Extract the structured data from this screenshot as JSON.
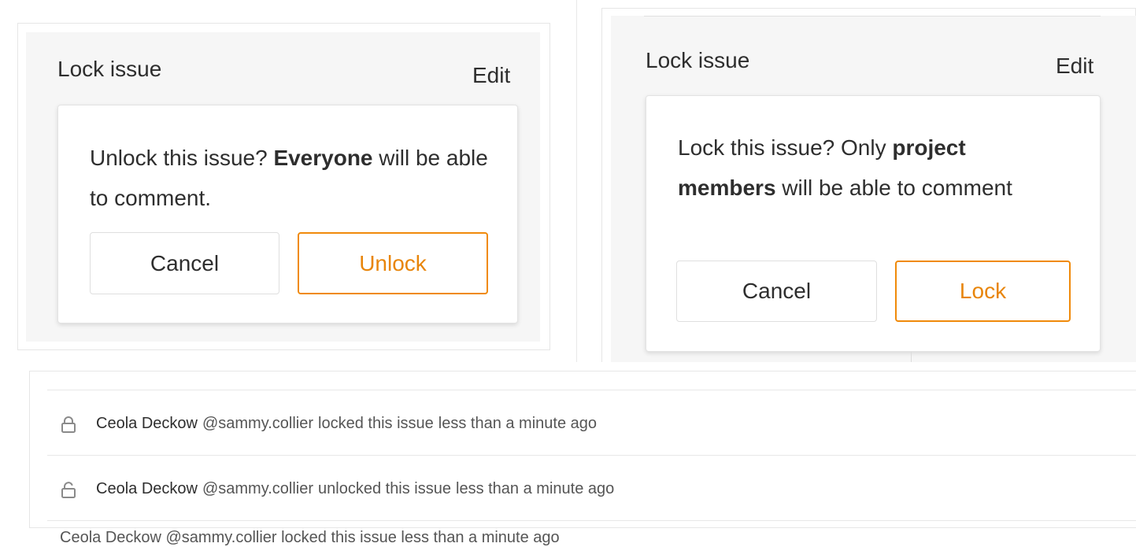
{
  "unlock_panel": {
    "title": "Lock issue",
    "edit_label": "Edit",
    "message_before": "Unlock this issue? ",
    "message_bold": "Everyone",
    "message_after": " will be able to comment.",
    "cancel_label": "Cancel",
    "confirm_label": "Unlock"
  },
  "lock_panel": {
    "title": "Lock issue",
    "edit_label": "Edit",
    "message_before": "Lock this issue? Only ",
    "message_bold": "project members",
    "message_after": " will be able to comment",
    "cancel_label": "Cancel",
    "confirm_label": "Lock"
  },
  "timeline": {
    "notes": [
      {
        "icon": "lock-icon",
        "author": "Ceola Deckow",
        "username": "@sammy.collier",
        "action": "locked this issue",
        "time": "less than a minute ago"
      },
      {
        "icon": "unlock-icon",
        "author": "Ceola Deckow",
        "username": "@sammy.collier",
        "action": "unlocked this issue",
        "time": "less than a minute ago"
      }
    ],
    "partial_note": "Ceola Deckow @sammy.collier locked this issue less than a minute ago"
  },
  "colors": {
    "warning": "#e8850a",
    "panel_background": "#f6f6f6",
    "border": "#e3e3e3"
  }
}
